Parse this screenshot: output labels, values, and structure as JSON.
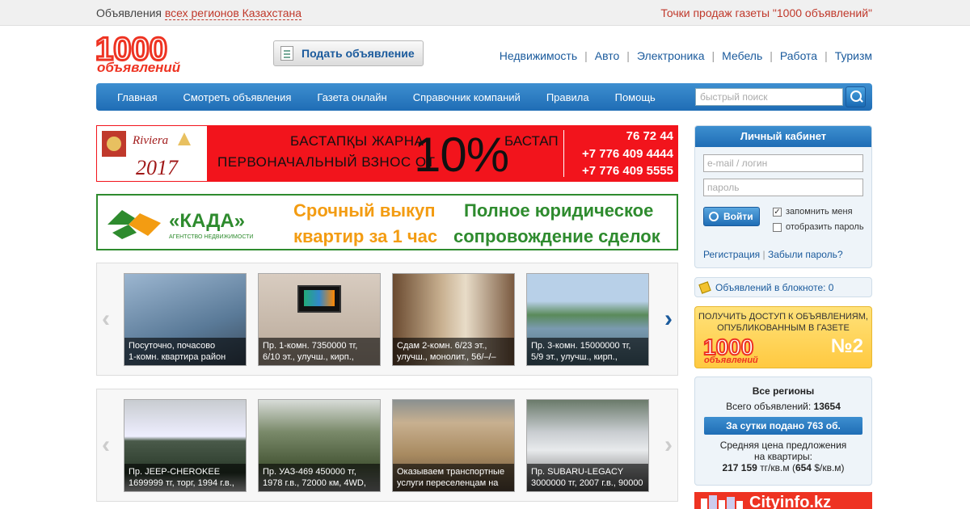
{
  "topbar": {
    "left_prefix": "Объявления",
    "left_link": "всех регионов Казахстана",
    "right_link": "Точки продаж газеты \"1000 объявлений\""
  },
  "logo": {
    "number": "1000",
    "word": "объявлений"
  },
  "post_button": {
    "label": "Подать объявление"
  },
  "categories": [
    "Недвижимость",
    "Авто",
    "Электроника",
    "Мебель",
    "Работа",
    "Туризм"
  ],
  "main_nav": {
    "items": [
      "Главная",
      "Смотреть объявления",
      "Газета онлайн",
      "Справочник компаний",
      "Правила",
      "Помощь"
    ],
    "search_placeholder": "быстрый поиск"
  },
  "banner1": {
    "brand": "Riviera",
    "year": "2017",
    "line1": "БАСТАПҚЫ ЖАРНА",
    "line2": "ПЕРВОНАЧАЛЬНЫЙ ВЗНОС ОТ",
    "percent": "10%",
    "line3": "БАСТАП",
    "phones": [
      "76 72 44",
      "+7 776 409 4444",
      "+7 776 409 5555"
    ]
  },
  "banner2": {
    "brand": "«КАДА»",
    "sub": "АГЕНТСТВО НЕДВИЖИМОСТИ",
    "offer1_line1": "Срочный выкуп",
    "offer1_line2": "квартир за 1 час",
    "offer2_line1": "Полное юридическое",
    "offer2_line2": "сопровождение сделок"
  },
  "carousel1": {
    "cards": [
      {
        "line1": "Посуточно, почасово",
        "line2": "1-комн. квартира район",
        "color": "#6d8fb0"
      },
      {
        "line1": "Пр. 1-комн. 7350000 тг,",
        "line2": "6/10 эт., улучш., кирп.,",
        "color": "#c8b8a8"
      },
      {
        "line1": "Сдам 2-комн. 6/23 эт.,",
        "line2": "улучш., монолит., 56/–/–",
        "color": "#a08060"
      },
      {
        "line1": "Пр. 3-комн. 15000000 тг,",
        "line2": "5/9 эт., улучш., кирп.,",
        "color": "#7a9a6a"
      }
    ]
  },
  "carousel2": {
    "cards": [
      {
        "line1": "Пр. JEEP-CHEROKEE",
        "line2": "1699999 тг, торг, 1994 г.в.,",
        "color": "#5a6a5a"
      },
      {
        "line1": "Пр. УАЗ-469 450000 тг,",
        "line2": "1978 г.в., 72000 км, 4WD,",
        "color": "#6a7a5a"
      },
      {
        "line1": "Оказываем транспортные",
        "line2": "услуги переселенцам на",
        "color": "#8a7a60"
      },
      {
        "line1": "Пр. SUBARU-LEGACY",
        "line2": "3000000 тг, 2007 г.в., 90000",
        "color": "#8a8a8a"
      }
    ]
  },
  "cabinet": {
    "title": "Личный кабинет",
    "login_placeholder": "e-mail / логин",
    "password_placeholder": "пароль",
    "login_button": "Войти",
    "remember": "запомнить меня",
    "remember_checked": "✓",
    "show_password": "отобразить пароль",
    "register": "Регистрация",
    "separator": "|",
    "forgot": "Забыли пароль?"
  },
  "notebook": {
    "label": "Объявлений в блокноте: 0"
  },
  "promo": {
    "line1": "ПОЛУЧИТЬ ДОСТУП К ОБЪЯВЛЕНИЯМ,",
    "line2": "ОПУБЛИКОВАННЫМ В ГАЗЕТЕ",
    "number": "№2"
  },
  "stats": {
    "region": "Все регионы",
    "total_label": "Всего объявлений:",
    "total_value": "13654",
    "daily": "За сутки подано 763 об.",
    "avg_line1": "Средняя цена предложения",
    "avg_line2": "на квартиры:",
    "price": "217 159",
    "price_unit": "тг/кв.м",
    "price_usd": "654",
    "price_usd_unit": "$/кв.м"
  },
  "cityinfo": {
    "label": "Cityinfo.kz"
  },
  "colors": {
    "brand_red": "#e32",
    "nav_blue": "#1f6db5",
    "link_blue": "#1a5a9c",
    "banner_green": "#2e8b2e"
  }
}
